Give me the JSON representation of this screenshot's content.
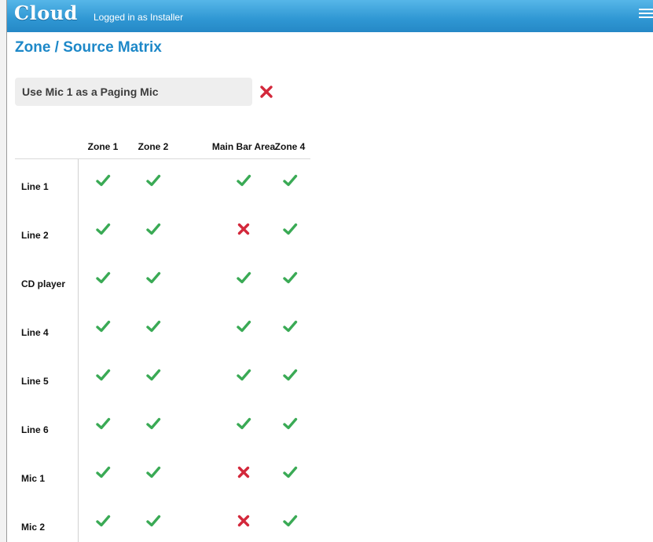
{
  "header": {
    "logo": "Cloud",
    "logged_in_text": "Logged in as Installer",
    "menu_icon": "hamburger-menu-icon"
  },
  "page": {
    "title": "Zone / Source Matrix"
  },
  "paging": {
    "label": "Use Mic 1 as a Paging Mic",
    "enabled": false,
    "icon": "cross-icon"
  },
  "colors": {
    "accent": "#1d88c8",
    "topbar": "#3aa0da",
    "check": "#3aaa55",
    "cross": "#d3283b"
  },
  "matrix": {
    "zones": [
      "Zone 1",
      "Zone 2",
      "Main Bar Area",
      "Zone 4"
    ],
    "sources": [
      {
        "name": "Line 1",
        "states": [
          true,
          true,
          true,
          true
        ]
      },
      {
        "name": "Line 2",
        "states": [
          true,
          true,
          false,
          true
        ]
      },
      {
        "name": "CD player",
        "states": [
          true,
          true,
          true,
          true
        ]
      },
      {
        "name": "Line 4",
        "states": [
          true,
          true,
          true,
          true
        ]
      },
      {
        "name": "Line 5",
        "states": [
          true,
          true,
          true,
          true
        ]
      },
      {
        "name": "Line 6",
        "states": [
          true,
          true,
          true,
          true
        ]
      },
      {
        "name": "Mic 1",
        "states": [
          true,
          true,
          false,
          true
        ]
      },
      {
        "name": "Mic 2",
        "states": [
          true,
          true,
          false,
          true
        ]
      }
    ]
  }
}
